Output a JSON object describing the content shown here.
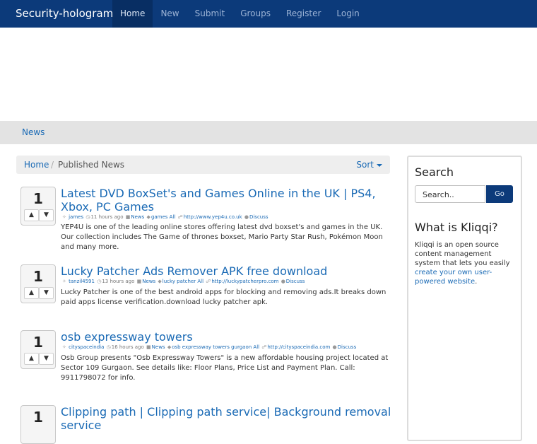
{
  "brand": "Security-hologram",
  "nav": [
    "Home",
    "New",
    "Submit",
    "Groups",
    "Register",
    "Login"
  ],
  "subnav": "News",
  "breadcrumb": {
    "home": "Home",
    "sep": "/",
    "current": "Published News",
    "sort": "Sort"
  },
  "stories": [
    {
      "votes": "1",
      "title": "Latest DVD BoxSet's and Games Online in the UK | PS4, Xbox, PC Games",
      "user": "james",
      "time": "11 hours ago",
      "category": "News",
      "tags": "games All",
      "url": "http://www.yep4u.co.uk",
      "discuss": "Discuss",
      "desc": "YEP4U is one of the leading online stores offering latest dvd boxset's and games in the UK. Our collection includes The Game of thrones boxset, Mario Party Star Rush, Pokémon Moon and many more."
    },
    {
      "votes": "1",
      "title": "Lucky Patcher Ads Remover APK free download",
      "user": "tanzil4591",
      "time": "13 hours ago",
      "category": "News",
      "tags": "lucky patcher All",
      "url": "http://luckypatcherpro.com",
      "discuss": "Discuss",
      "desc": "Lucky Patcher is one of the best android apps for blocking and removing ads.It breaks down paid apps license verification.download lucky patcher apk."
    },
    {
      "votes": "1",
      "title": "osb expressway towers",
      "user": "cityspaceindia",
      "time": "16 hours ago",
      "category": "News",
      "tags": "osb expressway towers gurgaon All",
      "url": "http://cityspaceindia.com",
      "discuss": "Discuss",
      "desc": "Osb Group presents \"Osb Expressway Towers\" is a new affordable housing project located at Sector 109 Gurgaon. See details like: Floor Plans, Price List and Payment Plan. Call: 9911798072 for info."
    },
    {
      "votes": "1",
      "title": "Clipping path | Clipping path service| Background removal service"
    }
  ],
  "sidebar": {
    "search_title": "Search",
    "search_placeholder": "Search..",
    "go": "Go",
    "about_title": "What is Kliqqi?",
    "about_text": "Kliqqi is an open source content management system that lets you easily ",
    "about_link": "create your own user-powered website",
    "about_end": "."
  }
}
